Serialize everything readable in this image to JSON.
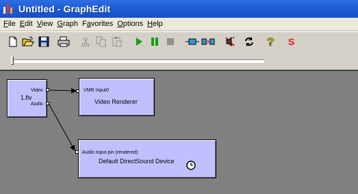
{
  "window": {
    "title": "Untitled - GraphEdit",
    "icon": "graphedit-app-icon"
  },
  "menu": [
    {
      "key": "file",
      "label": "File",
      "mnemonic": "F",
      "rest": "ile"
    },
    {
      "key": "edit",
      "label": "Edit",
      "mnemonic": "E",
      "rest": "dit"
    },
    {
      "key": "view",
      "label": "View",
      "mnemonic": "V",
      "rest": "iew"
    },
    {
      "key": "graph",
      "label": "Graph",
      "mnemonic": "G",
      "rest": "raph"
    },
    {
      "key": "favorites",
      "label": "Favorites",
      "mnemonic": "a",
      "pre": "F",
      "rest": "vorites"
    },
    {
      "key": "options",
      "label": "Options",
      "mnemonic": "O",
      "rest": "ptions"
    },
    {
      "key": "help",
      "label": "Help",
      "mnemonic": "H",
      "rest": "elp"
    }
  ],
  "toolbar": {
    "buttons": [
      {
        "name": "new-document-icon",
        "enabled": true
      },
      {
        "name": "open-folder-icon",
        "enabled": true
      },
      {
        "name": "save-disk-icon",
        "enabled": true
      },
      {
        "name": "print-icon",
        "enabled": true
      },
      {
        "name": "cut-icon",
        "enabled": false
      },
      {
        "name": "copy-icon",
        "enabled": false
      },
      {
        "name": "paste-icon",
        "enabled": false
      },
      {
        "name": "play-icon",
        "enabled": true
      },
      {
        "name": "pause-icon",
        "enabled": true
      },
      {
        "name": "stop-icon",
        "enabled": false
      },
      {
        "name": "seek-filter-icon",
        "enabled": true
      },
      {
        "name": "insert-filter-icon",
        "enabled": true
      },
      {
        "name": "speaker-mute-icon",
        "enabled": true
      },
      {
        "name": "refresh-icon",
        "enabled": true
      },
      {
        "name": "help-question-icon",
        "enabled": true
      },
      {
        "name": "sync-s-icon",
        "enabled": true
      }
    ]
  },
  "seek": {
    "position": 0
  },
  "graph": {
    "filters": [
      {
        "key": "source",
        "name": "1.flv",
        "pins_out": [
          {
            "label": "Video"
          },
          {
            "label": "Audio"
          }
        ]
      },
      {
        "key": "video_renderer",
        "name": "Video Renderer",
        "pins_in": [
          {
            "label": "VMR Input0"
          }
        ]
      },
      {
        "key": "audio_renderer",
        "name": "Default DirectSound Device",
        "pins_in": [
          {
            "label": "Audio Input pin (rendered)"
          }
        ],
        "clock_icon": "reference-clock-icon"
      }
    ],
    "connections": [
      {
        "from": "source.Video",
        "to": "video_renderer.VMR Input0"
      },
      {
        "from": "source.Audio",
        "to": "audio_renderer.Audio Input pin (rendered)"
      }
    ]
  },
  "colors": {
    "titlebar": "#1f5fd6",
    "filter_fill": "#c0c0ff",
    "graph_bg": "#808080",
    "sync_s": "#e02020",
    "play": "#11a011"
  }
}
